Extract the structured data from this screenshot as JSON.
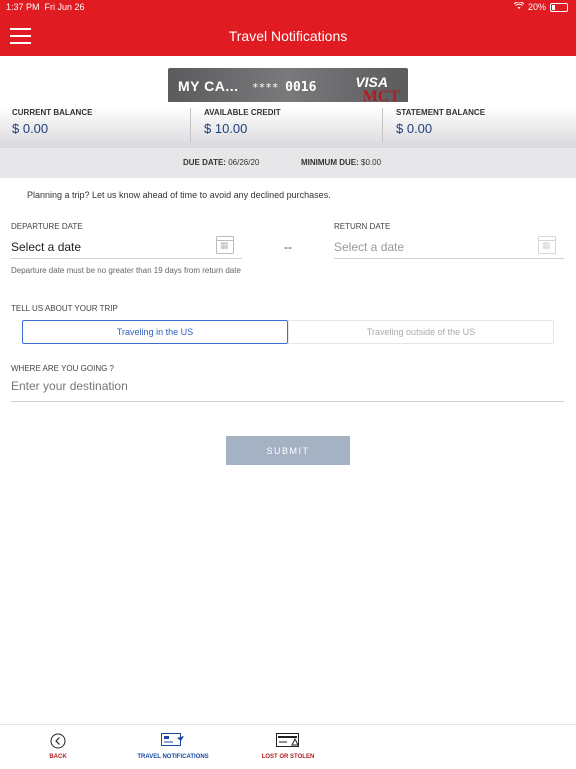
{
  "status_bar": {
    "time": "1:37 PM",
    "date": "Fri Jun 26",
    "battery": "20%"
  },
  "header": {
    "title": "Travel Notifications"
  },
  "card": {
    "name": "MY CA...",
    "number_mask": "****",
    "last4": "0016",
    "network": "VISA",
    "issuer": "MCT"
  },
  "balances": [
    {
      "label": "CURRENT BALANCE",
      "value": "$ 0.00"
    },
    {
      "label": "AVAILABLE CREDIT",
      "value": "$ 10.00"
    },
    {
      "label": "STATEMENT BALANCE",
      "value": "$ 0.00"
    }
  ],
  "due": {
    "due_label": "DUE DATE:",
    "due_value": "06/26/20",
    "min_label": "MINIMUM DUE:",
    "min_value": "$0.00"
  },
  "intro": "Planning a trip? Let us know ahead of time to avoid any declined purchases.",
  "departure": {
    "label": "DEPARTURE DATE",
    "value": "Select a date"
  },
  "separator": "--",
  "return": {
    "label": "RETURN DATE",
    "placeholder": "Select a date"
  },
  "hint": "Departure date must be no greater than 19 days from return date",
  "trip": {
    "label": "TELL US ABOUT YOUR TRIP",
    "options": [
      "Traveling in the US",
      "Traveling outside of the US"
    ],
    "selected": "Traveling in the US"
  },
  "destination": {
    "label": "WHERE ARE YOU GOING ?",
    "placeholder": "Enter your destination"
  },
  "submit_label": "SUBMIT",
  "nav": {
    "back": "BACK",
    "travel": "TRAVEL NOTIFICATIONS",
    "lost": "LOST OR STOLEN"
  },
  "colors": {
    "brand_red": "#e11b22",
    "link_blue": "#2d5fbf",
    "submit_disabled": "#a4b2c4"
  }
}
